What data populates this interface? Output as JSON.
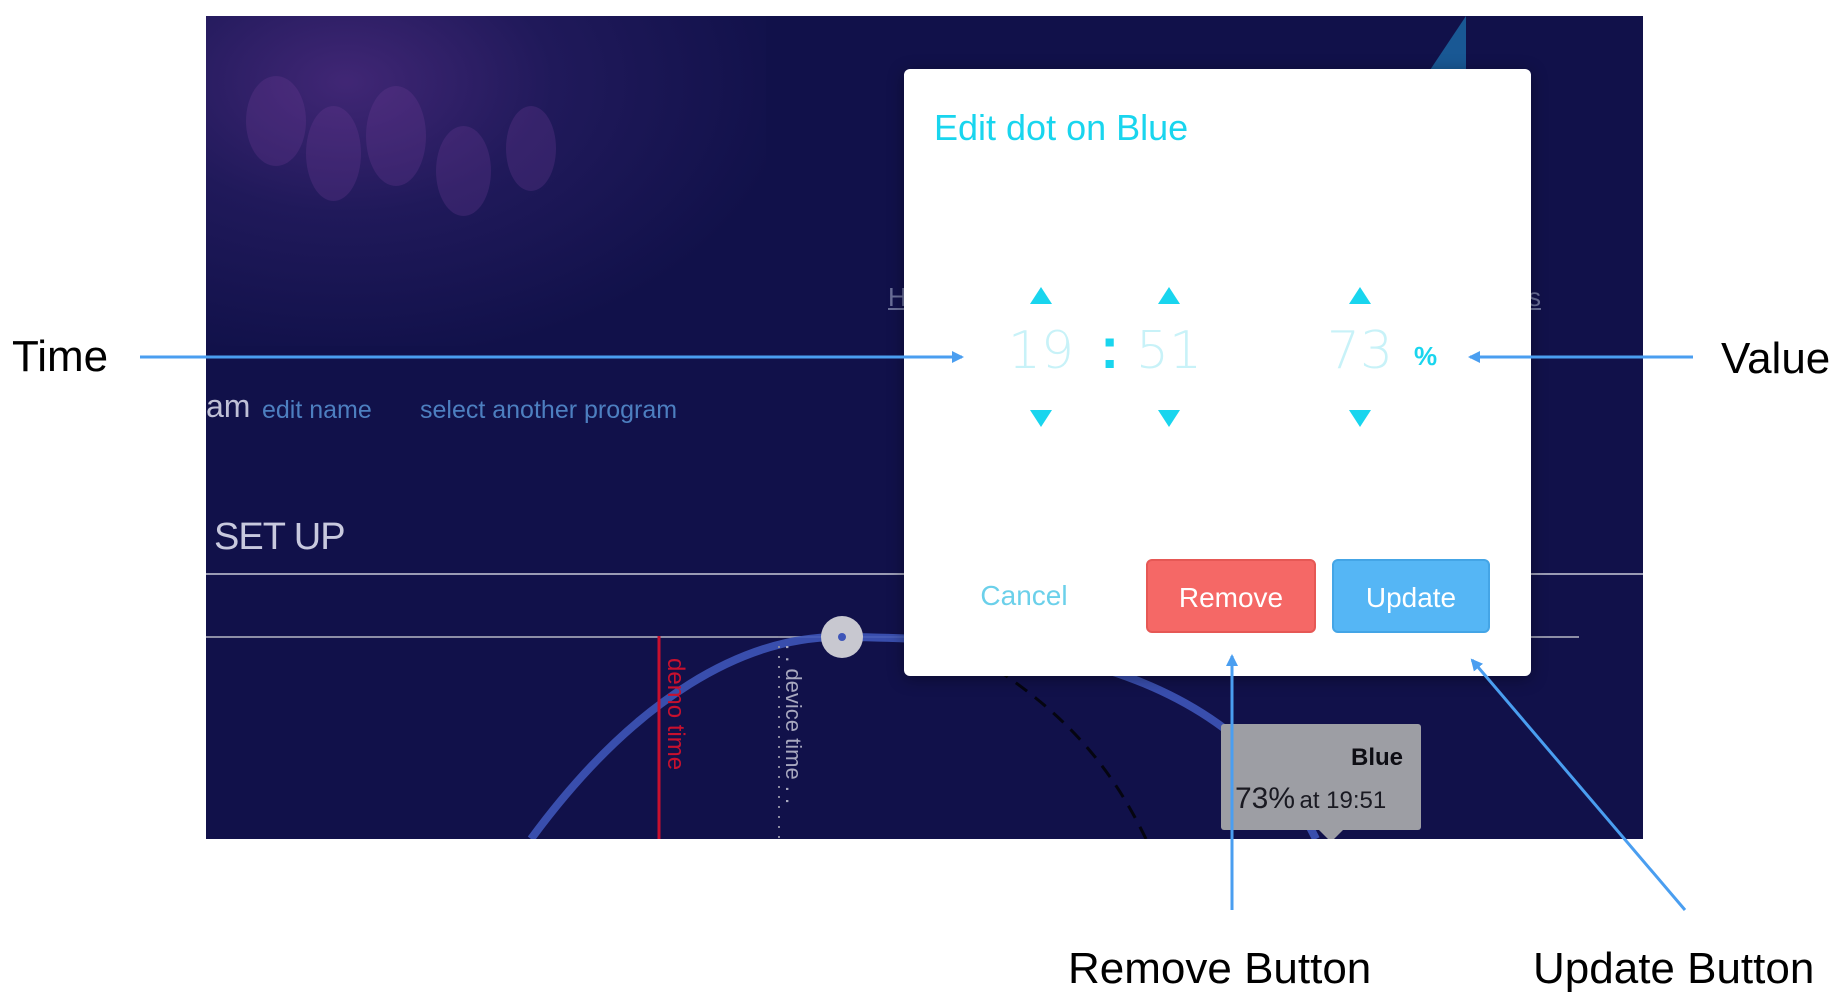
{
  "background_app": {
    "program_label_fragment": "am",
    "edit_name_link": "edit name",
    "select_program_link": "select another program",
    "setup_title": "SET UP",
    "peek_left_link": "H",
    "peek_right_link": "s",
    "demo_time_label": "demo time",
    "device_time_label": ". . device time . ."
  },
  "tooltip": {
    "channel": "Blue",
    "value": "73%",
    "at_text": "at 19:51"
  },
  "modal": {
    "title": "Edit dot on Blue",
    "hours": "19",
    "separator": ":",
    "minutes": "51",
    "value": "73",
    "unit": "%",
    "cancel_label": "Cancel",
    "remove_label": "Remove",
    "update_label": "Update"
  },
  "annotations": {
    "time": "Time",
    "value": "Value",
    "remove_button": "Remove Button",
    "update_button": "Update Button"
  },
  "colors": {
    "app_background": "#11114a",
    "accent_cyan": "#19d5ee",
    "remove_red": "#f56866",
    "update_blue": "#55b6f5",
    "annotation_arrow": "#4a9ef0",
    "curve_blue": "#3e55b8",
    "demo_time_red": "#c8102e"
  },
  "icons": [
    "arrow-up-icon",
    "arrow-down-icon",
    "curve-dot-icon"
  ]
}
